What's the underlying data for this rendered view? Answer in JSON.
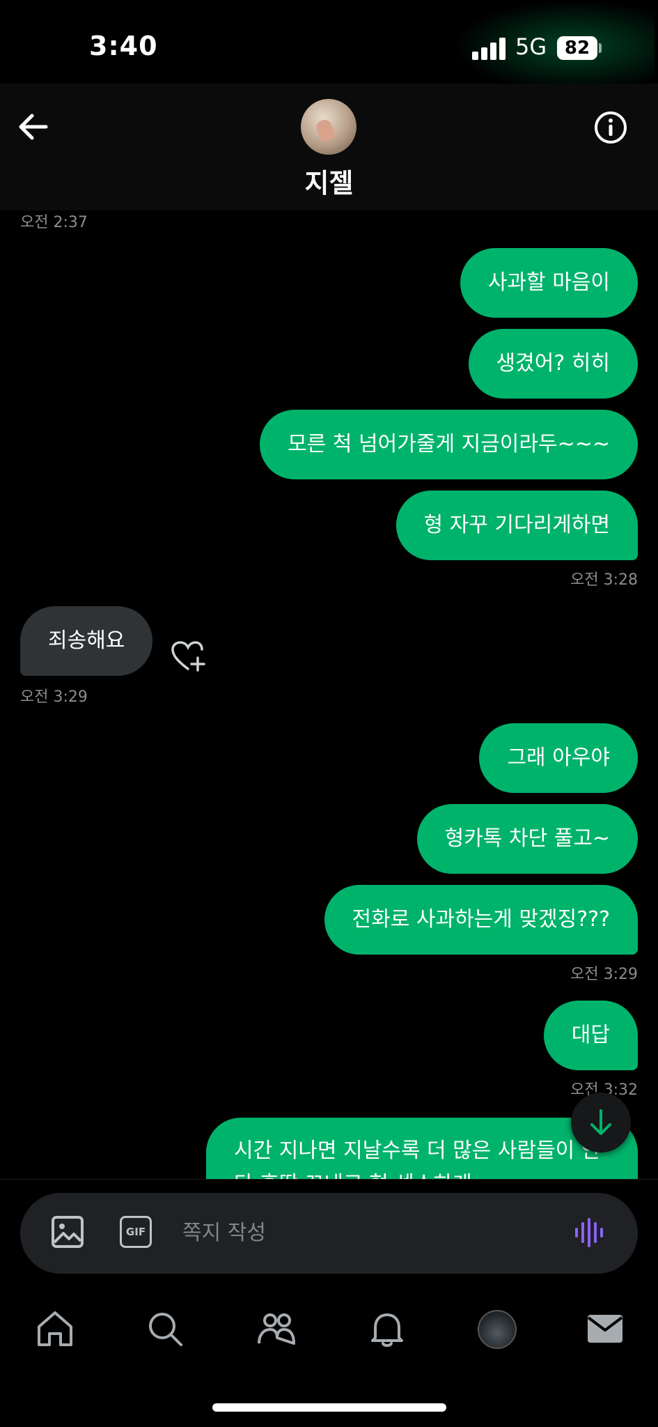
{
  "status_bar": {
    "time": "3:40",
    "network": "5G",
    "battery": "82"
  },
  "header": {
    "contact_name": "지젤"
  },
  "messages": [
    {
      "text": "사과할 마음이"
    },
    {
      "text": "생겼어? 히히"
    },
    {
      "text": "모른 척 넘어가줄게 지금이라두~~~"
    },
    {
      "text": "형 자꾸 기다리게하면"
    },
    {
      "text": "죄송해요"
    },
    {
      "text": "그래 아우야"
    },
    {
      "text": "형카톡 차단 풀고~"
    },
    {
      "text": "전화로 사과하는게 맞겠징???"
    },
    {
      "text": "대답"
    },
    {
      "text": "시간 지나면 지날수록 더 많은 사람들이 안 다 후딱 끄내고 형 센스하게"
    }
  ],
  "timestamps": {
    "t0": "오전 2:37",
    "t1": "오전 3:28",
    "t2": "오전 3:29",
    "t3": "오전 3:29",
    "t4": "오전 3:32"
  },
  "composer": {
    "placeholder": "쪽지 작성",
    "gif_label": "GIF"
  },
  "colors": {
    "accent": "#00b36b",
    "incoming_bubble": "#2f3336",
    "background": "#000000",
    "voice_icon": "#8b63f5"
  },
  "icons": {
    "back": "back-arrow-icon",
    "info": "info-icon",
    "reaction": "heart-plus-icon",
    "scroll": "arrow-down-icon",
    "image": "image-icon",
    "gif": "gif-icon",
    "voice": "voice-wave-icon",
    "nav": [
      "home-icon",
      "search-icon",
      "communities-icon",
      "notifications-icon",
      "profile-avatar",
      "messages-icon"
    ]
  }
}
